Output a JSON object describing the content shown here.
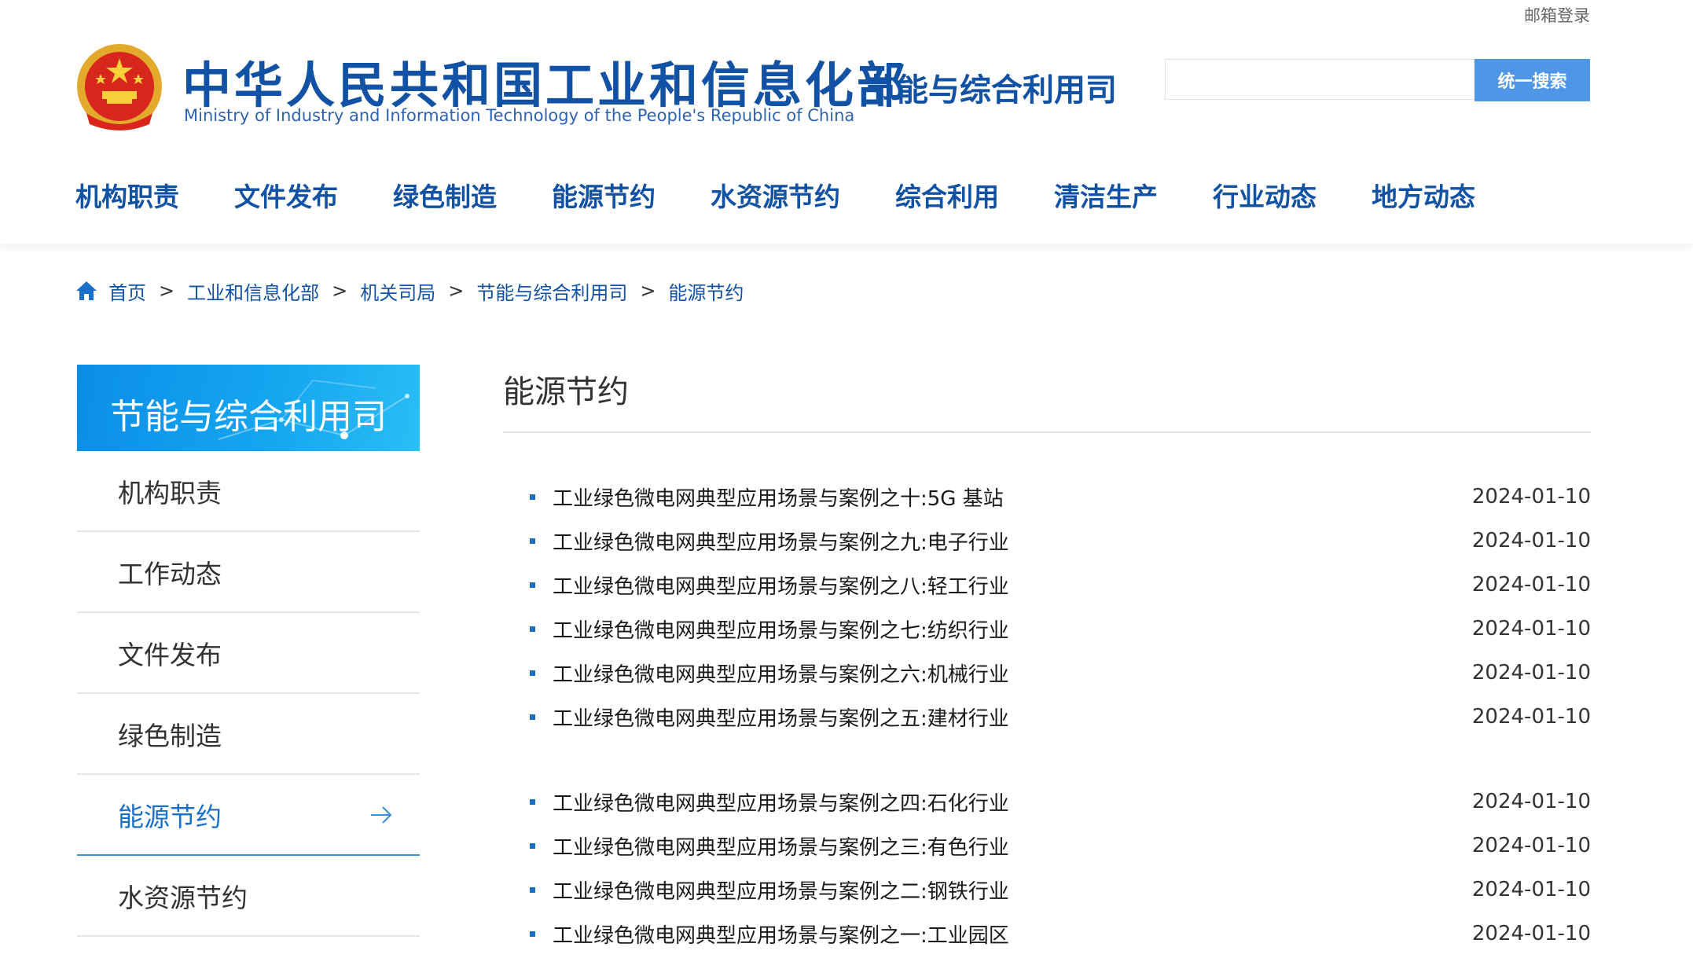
{
  "header": {
    "mail_link": "邮箱登录",
    "title_cn": "中华人民共和国工业和信息化部",
    "title_en": "Ministry of Industry and Information Technology of the People's Republic of China",
    "dept_title": "节能与综合利用司",
    "search_placeholder": "",
    "search_button": "统一搜索",
    "emblem_icon": "national-emblem-icon"
  },
  "nav": {
    "items": [
      "机构职责",
      "文件发布",
      "绿色制造",
      "能源节约",
      "水资源节约",
      "综合利用",
      "清洁生产",
      "行业动态",
      "地方动态"
    ]
  },
  "breadcrumb": {
    "icon": "home-icon",
    "items": [
      "首页",
      "工业和信息化部",
      "机关司局",
      "节能与综合利用司",
      "能源节约"
    ],
    "separator": ">"
  },
  "sidebar": {
    "banner_title": "节能与综合利用司",
    "items": [
      "机构职责",
      "工作动态",
      "文件发布",
      "绿色制造",
      "能源节约",
      "水资源节约"
    ],
    "active_index": 4
  },
  "main": {
    "title": "能源节约",
    "articles": [
      {
        "title": "工业绿色微电网典型应用场景与案例之十:5G 基站",
        "date": "2024-01-10"
      },
      {
        "title": "工业绿色微电网典型应用场景与案例之九:电子行业",
        "date": "2024-01-10"
      },
      {
        "title": "工业绿色微电网典型应用场景与案例之八:轻工行业",
        "date": "2024-01-10"
      },
      {
        "title": "工业绿色微电网典型应用场景与案例之七:纺织行业",
        "date": "2024-01-10"
      },
      {
        "title": "工业绿色微电网典型应用场景与案例之六:机械行业",
        "date": "2024-01-10"
      },
      {
        "title": "工业绿色微电网典型应用场景与案例之五:建材行业",
        "date": "2024-01-10"
      },
      {
        "title": "工业绿色微电网典型应用场景与案例之四:石化行业",
        "date": "2024-01-10"
      },
      {
        "title": "工业绿色微电网典型应用场景与案例之三:有色行业",
        "date": "2024-01-10"
      },
      {
        "title": "工业绿色微电网典型应用场景与案例之二:钢铁行业",
        "date": "2024-01-10"
      },
      {
        "title": "工业绿色微电网典型应用场景与案例之一:工业园区",
        "date": "2024-01-10"
      }
    ]
  },
  "colors": {
    "brand_blue": "#1252a4",
    "link_blue": "#1a6fc9",
    "search_button": "#4f97e6",
    "banner_start": "#0a8ee8",
    "banner_end": "#2bbdf5"
  }
}
